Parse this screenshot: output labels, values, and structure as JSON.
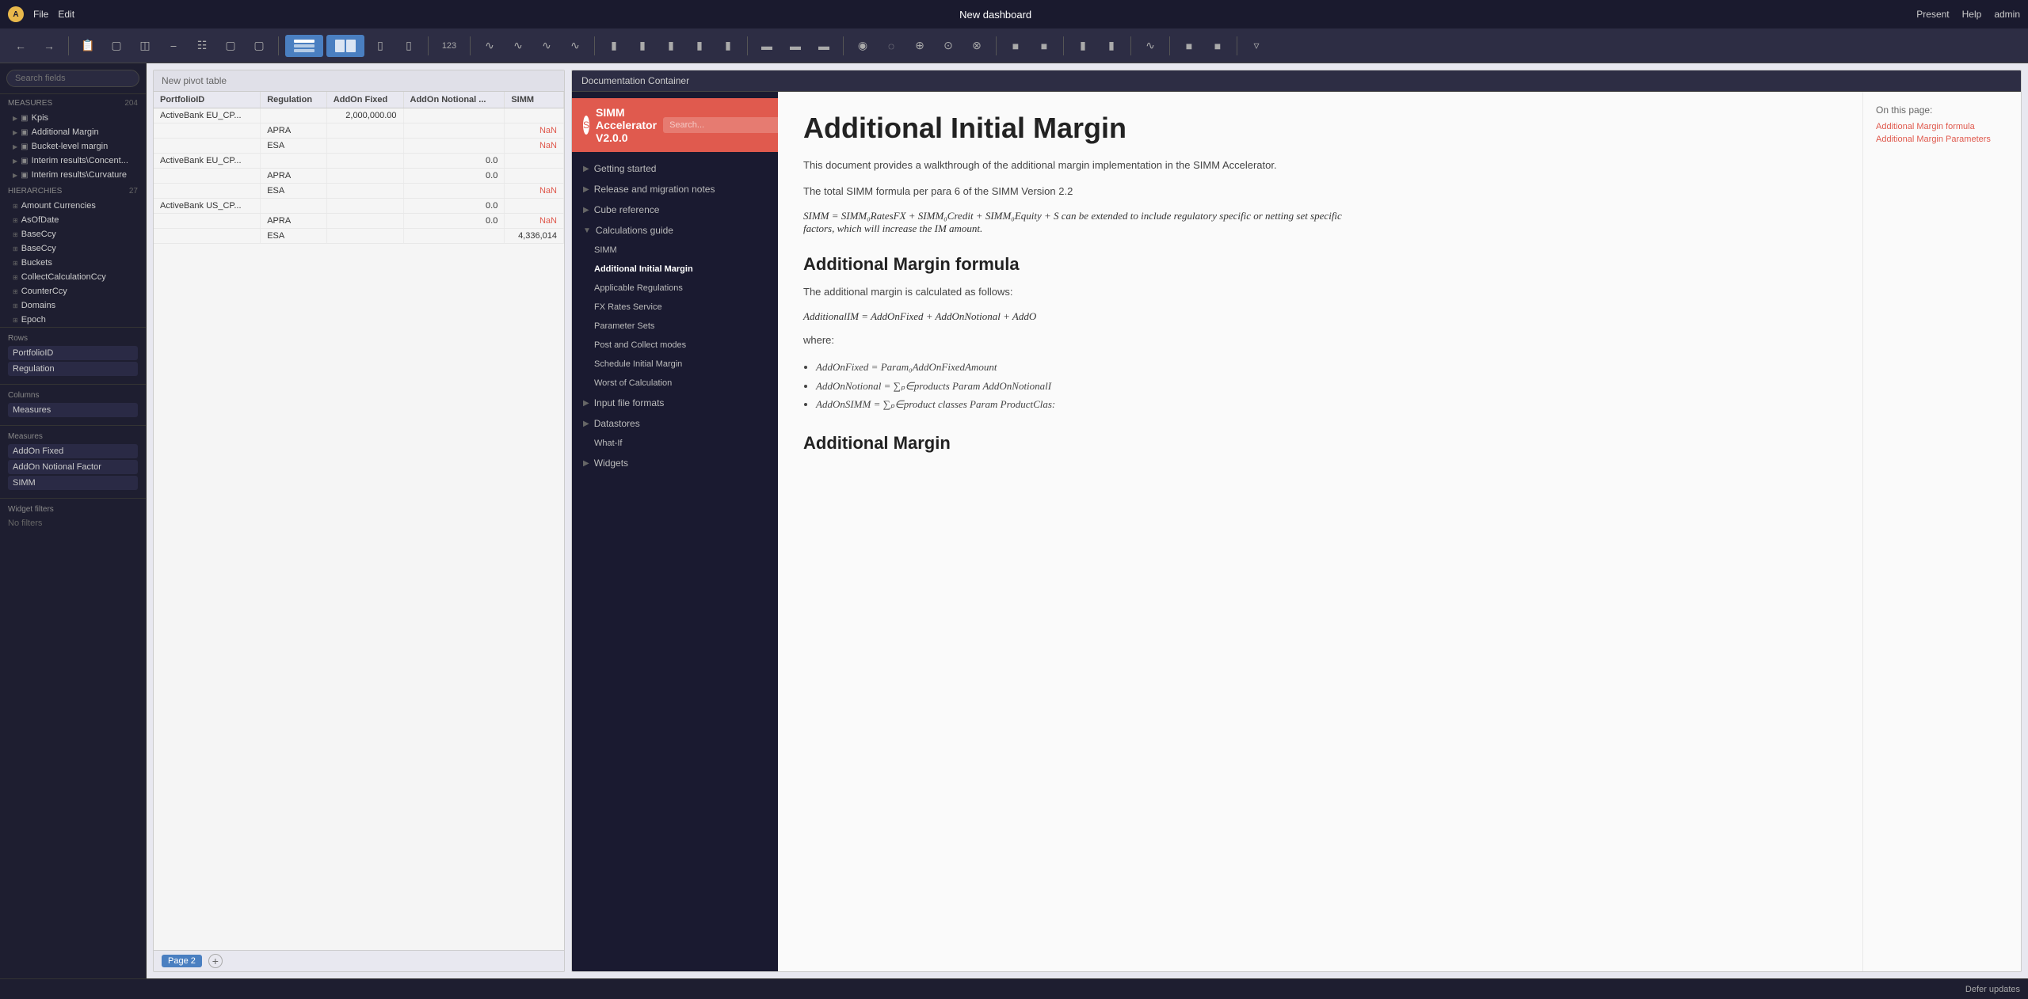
{
  "topbar": {
    "logo_text": "A",
    "menu": [
      "File",
      "Edit"
    ],
    "title": "New dashboard",
    "right": [
      "Present",
      "Help",
      "admin"
    ]
  },
  "toolbar": {
    "groups": [
      {
        "items": [
          "←",
          "→"
        ]
      },
      {
        "items": [
          "📋",
          "⬡",
          "⊞",
          "⊕",
          "≡",
          "⊏",
          "⊐"
        ]
      },
      {
        "items": [
          "▦",
          "▦▦",
          "▪▦",
          "▨"
        ]
      },
      {
        "items": [
          "123"
        ]
      },
      {
        "items": [
          "∿",
          "∿∿",
          "≋",
          "≋≋"
        ]
      },
      {
        "items": [
          "▐▌",
          "▐▌▌",
          "▐▐▌",
          "▐▐▌▌",
          "▐▐▐▌"
        ]
      },
      {
        "items": [
          "≡≡",
          "≡≡≡",
          "≡≡≡≡"
        ]
      },
      {
        "items": [
          "◎",
          "◑",
          "⊕",
          "⊙",
          "⊗"
        ]
      },
      {
        "items": [
          "⊞",
          "⊡",
          "⊠"
        ]
      },
      {
        "items": [
          "⊗"
        ]
      },
      {
        "items": [
          "▼"
        ]
      }
    ]
  },
  "sidebar": {
    "search_placeholder": "Search fields",
    "measures_label": "MEASURES",
    "measures_count": "204",
    "measures": [
      {
        "name": "Kpis",
        "type": "folder"
      },
      {
        "name": "Additional Margin",
        "type": "folder"
      },
      {
        "name": "Bucket-level margin",
        "type": "folder"
      },
      {
        "name": "Interim results\\Concent...",
        "type": "folder"
      },
      {
        "name": "Interim results\\Curvature",
        "type": "folder"
      }
    ],
    "hierarchies_label": "HIERARCHIES",
    "hierarchies_count": "27",
    "hierarchies": [
      {
        "name": "Amount Currencies"
      },
      {
        "name": "AsOfDate"
      },
      {
        "name": "BaseCcy"
      },
      {
        "name": "BaseCcy"
      },
      {
        "name": "Buckets"
      },
      {
        "name": "CollectCalculationCcy"
      },
      {
        "name": "CounterCcy"
      },
      {
        "name": "Domains"
      },
      {
        "name": "Epoch"
      }
    ],
    "rows_label": "Rows",
    "rows": [
      "PortfolioID",
      "Regulation"
    ],
    "columns_label": "Columns",
    "columns": [
      "Measures"
    ],
    "measures_section_label": "Measures",
    "measures_items": [
      "AddOn Fixed",
      "AddOn Notional Factor",
      "SIMM"
    ],
    "widget_filters_label": "Widget filters",
    "no_filters": "No filters"
  },
  "pivot": {
    "header": "New pivot table",
    "columns": [
      "PortfolioID",
      "Regulation",
      "AddOn Fixed",
      "AddOn Notional ...",
      "SIMM"
    ],
    "rows": [
      {
        "portfolioId": "ActiveBank EU_CP...",
        "regulation": "",
        "addOnFixed": "2,000,000.00",
        "addOnNotional": "",
        "simm": ""
      },
      {
        "portfolioId": "",
        "regulation": "APRA",
        "addOnFixed": "",
        "addOnNotional": "",
        "simm": "NaN"
      },
      {
        "portfolioId": "",
        "regulation": "ESA",
        "addOnFixed": "",
        "addOnNotional": "",
        "simm": "NaN"
      },
      {
        "portfolioId": "ActiveBank EU_CP...",
        "regulation": "",
        "addOnFixed": "",
        "addOnNotional": "0.0",
        "simm": ""
      },
      {
        "portfolioId": "",
        "regulation": "APRA",
        "addOnFixed": "",
        "addOnNotional": "0.0",
        "simm": ""
      },
      {
        "portfolioId": "",
        "regulation": "ESA",
        "addOnFixed": "",
        "addOnNotional": "",
        "simm": "NaN"
      },
      {
        "portfolioId": "ActiveBank US_CP...",
        "regulation": "",
        "addOnFixed": "",
        "addOnNotional": "0.0",
        "simm": ""
      },
      {
        "portfolioId": "",
        "regulation": "APRA",
        "addOnFixed": "",
        "addOnNotional": "0.0",
        "simm": "NaN"
      },
      {
        "portfolioId": "",
        "regulation": "ESA",
        "addOnFixed": "",
        "addOnNotional": "",
        "simm": "4,336,014"
      }
    ],
    "footer_page": "Page 2"
  },
  "doc_container": {
    "header": "Documentation Container",
    "logo_title": "SIMM Accelerator V2.0.0",
    "search_placeholder": "Search...",
    "nav": [
      {
        "label": "Getting started",
        "type": "collapsed",
        "level": 0
      },
      {
        "label": "Release and migration notes",
        "type": "collapsed",
        "level": 0
      },
      {
        "label": "Cube reference",
        "type": "collapsed",
        "level": 0
      },
      {
        "label": "Calculations guide",
        "type": "open",
        "level": 0
      },
      {
        "label": "SIMM",
        "type": "sub",
        "level": 1
      },
      {
        "label": "Additional Initial Margin",
        "type": "sub active",
        "level": 1
      },
      {
        "label": "Applicable Regulations",
        "type": "sub",
        "level": 1
      },
      {
        "label": "FX Rates Service",
        "type": "sub",
        "level": 1
      },
      {
        "label": "Parameter Sets",
        "type": "sub",
        "level": 1
      },
      {
        "label": "Post and Collect modes",
        "type": "sub",
        "level": 1
      },
      {
        "label": "Schedule Initial Margin",
        "type": "sub",
        "level": 1
      },
      {
        "label": "Worst of Calculation",
        "type": "sub",
        "level": 1
      },
      {
        "label": "Input file formats",
        "type": "collapsed",
        "level": 0
      },
      {
        "label": "Datastores",
        "type": "collapsed",
        "level": 0
      },
      {
        "label": "What-If",
        "type": "item",
        "level": 1
      },
      {
        "label": "Widgets",
        "type": "collapsed",
        "level": 0
      }
    ],
    "content": {
      "title": "Additional Initial Margin",
      "subtitle1": "Additional Margin formula",
      "subtitle2": "Additional Margin",
      "intro": "This document provides a walkthrough of the additional margin implementation in the SIMM Accelerator.",
      "formula_intro": "The total SIMM formula per para 6 of the SIMM Version 2.2",
      "formula_main": "SIMM = SIMM₀RatesFX + SIMM₀Credit + SIMM₀Equity + S can be extended to include regulatory specific or netting set specific factors, which will increase the IM amount.",
      "formula_section": "The additional margin is calculated as follows:",
      "formula_body": "AdditionalIM = AddOnFixed + AddOnNotional + AddO",
      "where_label": "where:",
      "list_items": [
        "AddOnFixed = Param₀AddOnFixedAmount",
        "AddOnNotional = ∑ₚ∈products Param AddOnNotionalI",
        "AddOnSIMM = ∑ₚ∈product classes Param ProductClas:"
      ]
    },
    "toc": {
      "title": "On this page:",
      "links": [
        "Additional Margin formula",
        "Additional Margin Parameters"
      ]
    }
  },
  "bottombar": {
    "defer_label": "Defer updates"
  }
}
